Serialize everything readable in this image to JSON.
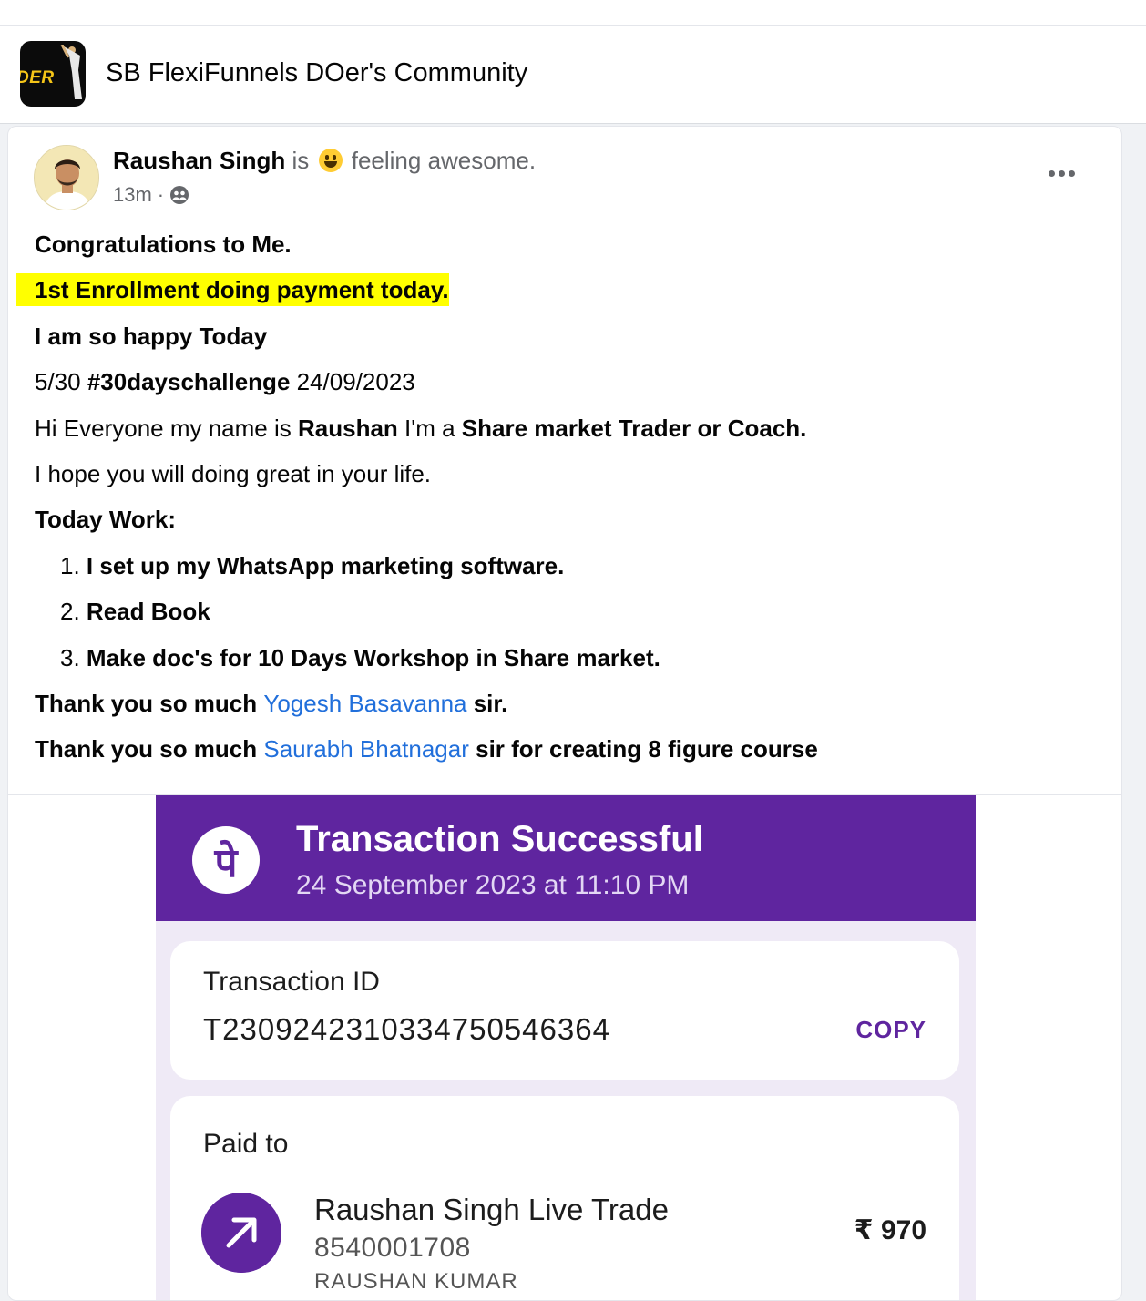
{
  "group": {
    "logo_text": "DER",
    "title": "SB FlexiFunnels DOer's Community"
  },
  "post": {
    "author": "Raushan Singh",
    "is_word": "is",
    "feeling": "feeling awesome.",
    "time": "13m",
    "separator": "·",
    "lines": {
      "l1": "Congratulations to Me.",
      "l2": "1st Enrollment doing payment today.",
      "l3": "I am so happy Today",
      "l4_a": "5/30 ",
      "l4_b": "#30dayschallenge",
      "l4_c": " 24/09/2023",
      "l5_a": "Hi Everyone my name is ",
      "l5_b": "Raushan",
      "l5_c": " I'm a ",
      "l5_d": "Share market Trader or Coach.",
      "l6": "I hope you will doing great in your life.",
      "l7": "Today Work:",
      "list": [
        "I set up my WhatsApp marketing software.",
        "Read Book",
        "Make doc's for 10 Days Workshop in Share market."
      ],
      "list_nums": [
        "1.",
        "2.",
        "3."
      ],
      "l8_a": "Thank you so much ",
      "l8_link": "Yogesh Basavanna",
      "l8_c": " sir.",
      "l9_a": "Thank you so much ",
      "l9_link": "Saurabh Bhatnagar",
      "l9_c": " sir for creating 8 figure course"
    }
  },
  "receipt": {
    "logo_glyph": "पे",
    "title": "Transaction Successful",
    "date": "24 September 2023 at 11:10 PM",
    "id_label": "Transaction ID",
    "id_value": "T2309242310334750546364",
    "copy_label": "COPY",
    "paid_to_label": "Paid to",
    "payee_name": "Raushan Singh Live Trade",
    "payee_phone": "8540001708",
    "payee_alt": "RAUSHAN KUMAR",
    "amount": "₹ 970"
  },
  "colors": {
    "brand_purple": "#5f259f",
    "link_blue": "#216fdb",
    "highlight": "#ffff00"
  }
}
